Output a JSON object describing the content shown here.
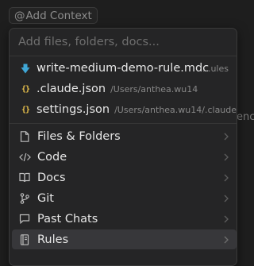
{
  "add_context": {
    "at_symbol": "@",
    "label": "Add Context"
  },
  "background_text": "enc",
  "search": {
    "placeholder": "Add files, folders, docs...",
    "value": ""
  },
  "recent_files": [
    {
      "name": "write-medium-demo-rule.mdc",
      "path": "...ules",
      "icon": "mdc-file-icon"
    },
    {
      "name": ".claude.json",
      "path": "/Users/anthea.wu14",
      "icon": "json-file-icon"
    },
    {
      "name": "settings.json",
      "path": "/Users/anthea.wu14/.claude",
      "icon": "json-file-icon"
    }
  ],
  "json_icon_glyph": "{}",
  "categories": [
    {
      "label": "Files & Folders",
      "icon": "file-icon",
      "selected": false
    },
    {
      "label": "Code",
      "icon": "code-icon",
      "selected": false
    },
    {
      "label": "Docs",
      "icon": "book-icon",
      "selected": false
    },
    {
      "label": "Git",
      "icon": "git-branch-icon",
      "selected": false
    },
    {
      "label": "Past Chats",
      "icon": "chat-icon",
      "selected": false
    },
    {
      "label": "Rules",
      "icon": "rules-icon",
      "selected": true
    }
  ],
  "colors": {
    "background": "#1e1e1e",
    "popup": "#252526",
    "selected_row": "#37373a",
    "mdc_icon": "#3fa7d6",
    "json_icon": "#e8c14c"
  }
}
